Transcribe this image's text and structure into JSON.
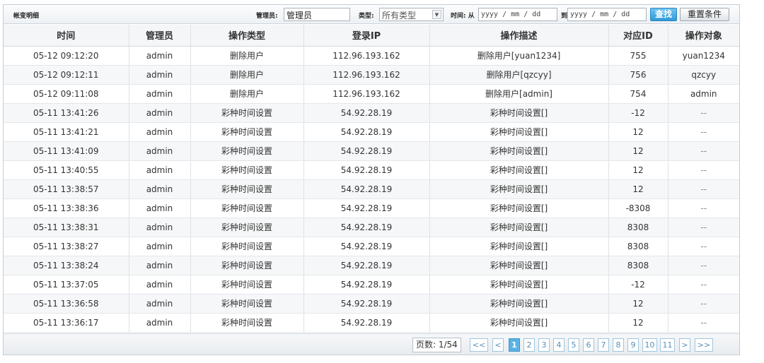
{
  "toolbar": {
    "title": "帐变明细",
    "admin_label": "管理员:",
    "admin_value": "管理员",
    "type_label": "类型:",
    "type_value": "所有类型",
    "time_label": "时间: 从",
    "date_from_placeholder": "yyyy / mm / dd",
    "to_label": "到",
    "date_to_placeholder": "yyyy / mm / dd",
    "search_label": "查找",
    "reset_label": "重置条件"
  },
  "table": {
    "headers": [
      "时间",
      "管理员",
      "操作类型",
      "登录IP",
      "操作描述",
      "对应ID",
      "操作对象"
    ],
    "rows": [
      [
        "05-12 09:12:20",
        "admin",
        "删除用户",
        "112.96.193.162",
        "删除用户[yuan1234]",
        "755",
        "yuan1234"
      ],
      [
        "05-12 09:12:11",
        "admin",
        "删除用户",
        "112.96.193.162",
        "删除用户[qzcyy]",
        "756",
        "qzcyy"
      ],
      [
        "05-12 09:11:08",
        "admin",
        "删除用户",
        "112.96.193.162",
        "删除用户[admin]",
        "754",
        "admin"
      ],
      [
        "05-11 13:41:26",
        "admin",
        "彩种时间设置",
        "54.92.28.19",
        "彩种时间设置[]",
        "-12",
        "--"
      ],
      [
        "05-11 13:41:21",
        "admin",
        "彩种时间设置",
        "54.92.28.19",
        "彩种时间设置[]",
        "12",
        "--"
      ],
      [
        "05-11 13:41:09",
        "admin",
        "彩种时间设置",
        "54.92.28.19",
        "彩种时间设置[]",
        "12",
        "--"
      ],
      [
        "05-11 13:40:55",
        "admin",
        "彩种时间设置",
        "54.92.28.19",
        "彩种时间设置[]",
        "12",
        "--"
      ],
      [
        "05-11 13:38:57",
        "admin",
        "彩种时间设置",
        "54.92.28.19",
        "彩种时间设置[]",
        "12",
        "--"
      ],
      [
        "05-11 13:38:36",
        "admin",
        "彩种时间设置",
        "54.92.28.19",
        "彩种时间设置[]",
        "-8308",
        "--"
      ],
      [
        "05-11 13:38:31",
        "admin",
        "彩种时间设置",
        "54.92.28.19",
        "彩种时间设置[]",
        "8308",
        "--"
      ],
      [
        "05-11 13:38:27",
        "admin",
        "彩种时间设置",
        "54.92.28.19",
        "彩种时间设置[]",
        "8308",
        "--"
      ],
      [
        "05-11 13:38:24",
        "admin",
        "彩种时间设置",
        "54.92.28.19",
        "彩种时间设置[]",
        "8308",
        "--"
      ],
      [
        "05-11 13:37:05",
        "admin",
        "彩种时间设置",
        "54.92.28.19",
        "彩种时间设置[]",
        "-12",
        "--"
      ],
      [
        "05-11 13:36:58",
        "admin",
        "彩种时间设置",
        "54.92.28.19",
        "彩种时间设置[]",
        "12",
        "--"
      ],
      [
        "05-11 13:36:17",
        "admin",
        "彩种时间设置",
        "54.92.28.19",
        "彩种时间设置[]",
        "12",
        "--"
      ]
    ]
  },
  "pager": {
    "info": "页数: 1/54",
    "first": "<<",
    "prev": "<",
    "pages": [
      "1",
      "2",
      "3",
      "4",
      "5",
      "6",
      "7",
      "8",
      "9",
      "10",
      "11"
    ],
    "current": "1",
    "next": ">",
    "last": ">>"
  }
}
